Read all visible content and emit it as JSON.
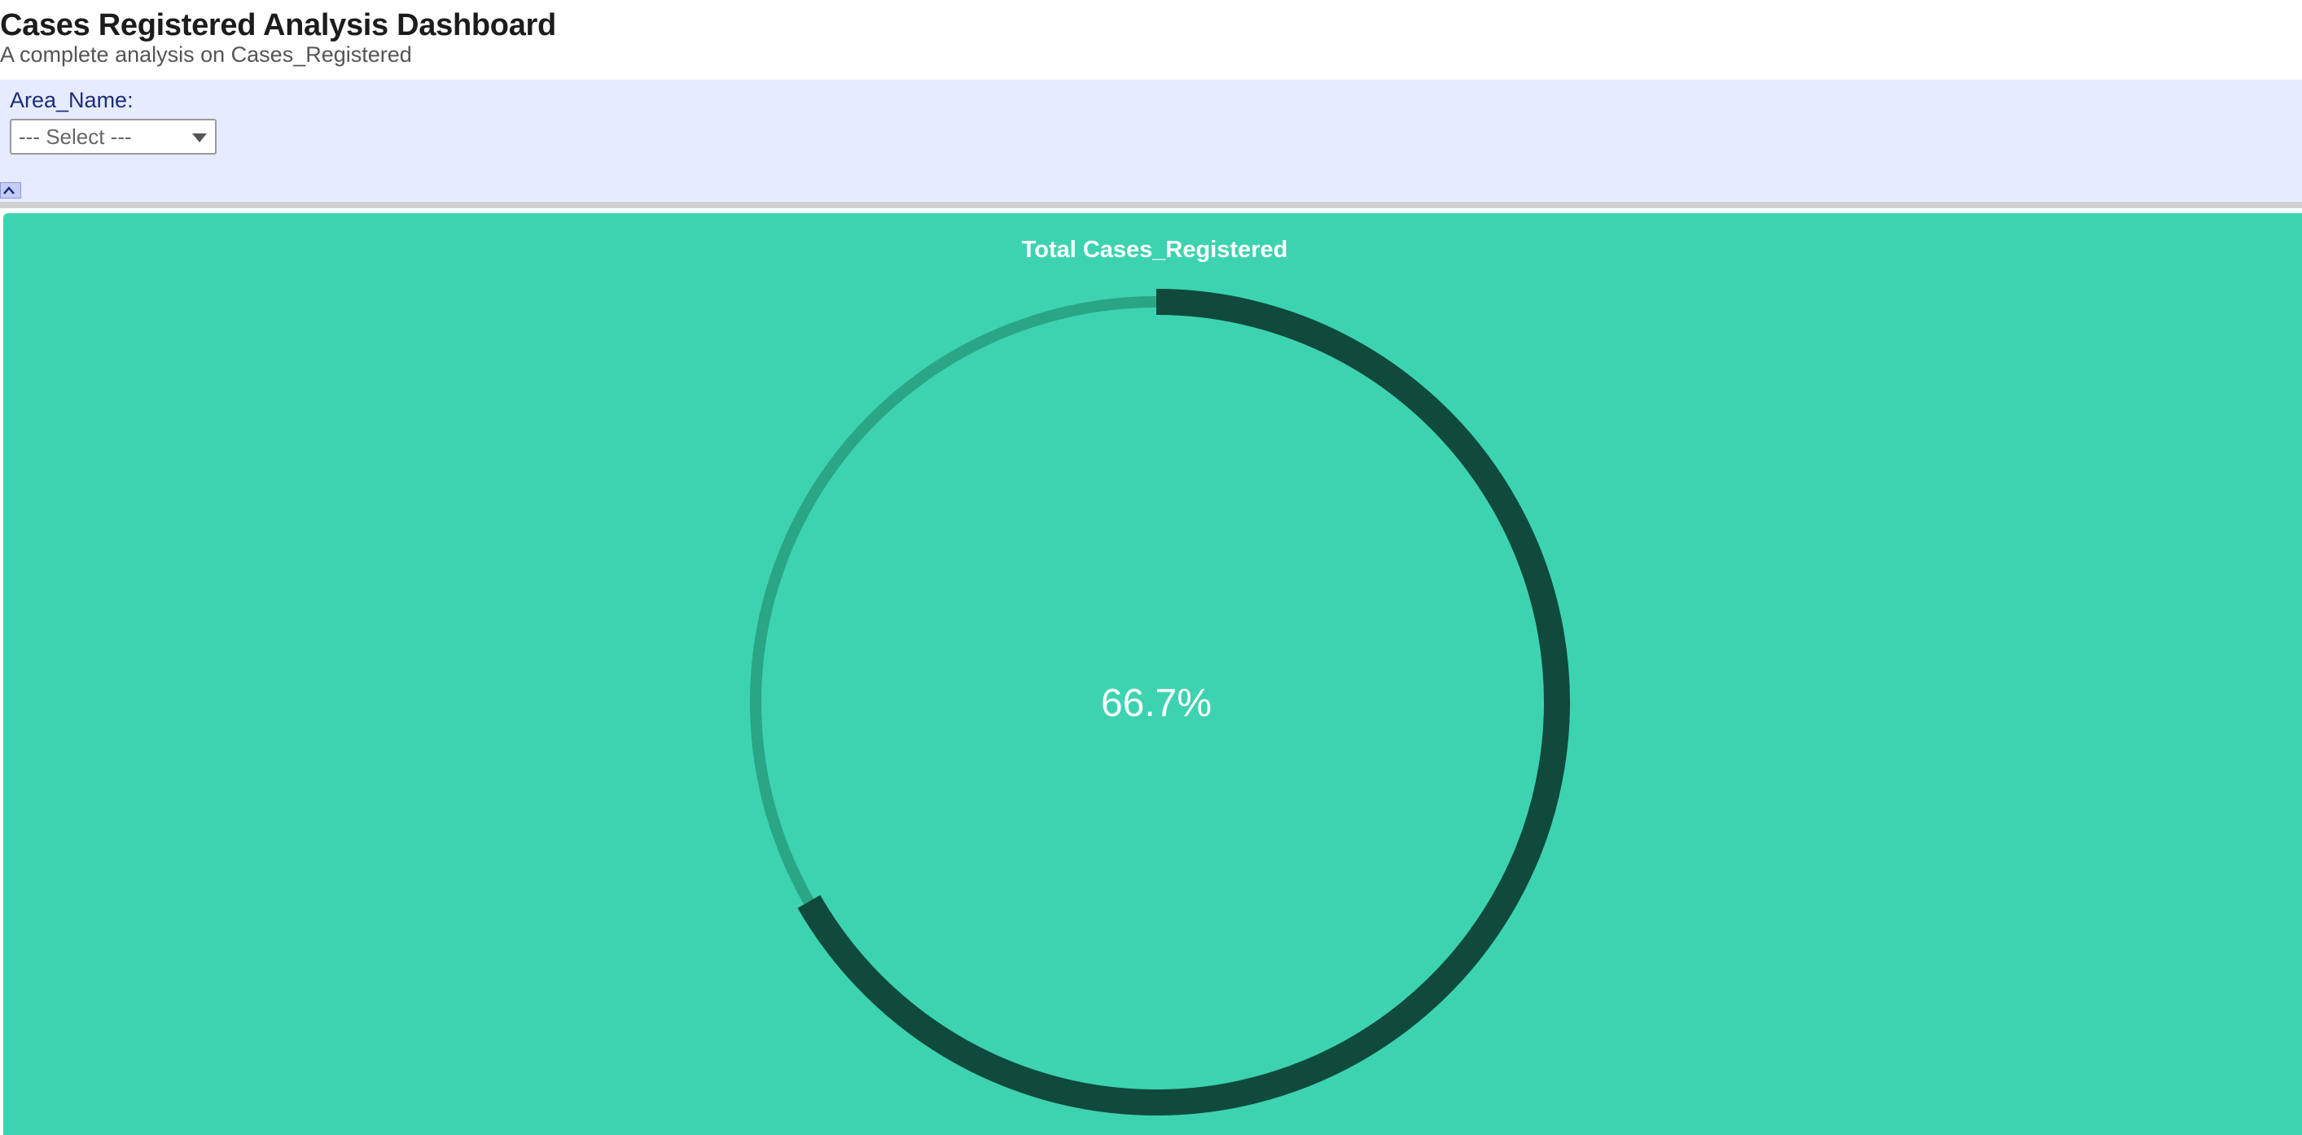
{
  "header": {
    "title": "Cases Registered Analysis Dashboard",
    "subtitle": "A complete analysis on Cases_Registered"
  },
  "filters": {
    "area_name_label": "Area_Name:",
    "area_name_selected": "--- Select ---"
  },
  "kpi": {
    "title": "Total Cases_Registered",
    "value_text": "66.7%",
    "fraction": 0.667
  },
  "icons": {
    "collapse": "chevron-up-icon",
    "dropdown": "chevron-down-icon"
  },
  "colors": {
    "filter_bar": "#e6ebff",
    "panel": "#3dd3b0",
    "gauge_track": "#2aa585",
    "gauge_fill": "#0f4a3d",
    "label": "#1f2d7a"
  }
}
